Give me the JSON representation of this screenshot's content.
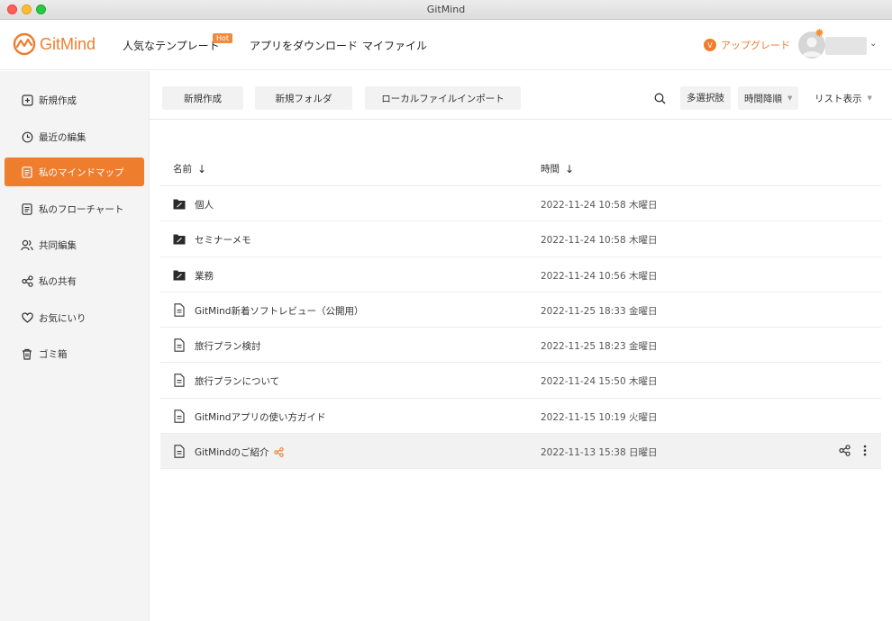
{
  "window": {
    "title": "GitMind"
  },
  "header": {
    "logo_text": "GitMind",
    "nav": [
      {
        "label": "人気なテンプレート",
        "badge": "Hot"
      },
      {
        "label": "アプリをダウンロード"
      },
      {
        "label": "マイファイル"
      }
    ],
    "upgrade_label": "アップグレード"
  },
  "sidebar": {
    "items": [
      {
        "label": "新規作成",
        "icon": "new-icon"
      },
      {
        "label": "最近の編集",
        "icon": "clock-icon"
      },
      {
        "label": "私のマインドマップ",
        "icon": "document-icon",
        "active": true
      },
      {
        "label": "私のフローチャート",
        "icon": "document-icon"
      },
      {
        "label": "共同編集",
        "icon": "users-icon"
      },
      {
        "label": "私の共有",
        "icon": "share-icon"
      },
      {
        "label": "お気にいり",
        "icon": "heart-icon"
      },
      {
        "label": "ゴミ箱",
        "icon": "trash-icon"
      }
    ]
  },
  "toolbar": {
    "new_label": "新規作成",
    "new_folder_label": "新規フォルダ",
    "import_label": "ローカルファイルインポート",
    "multi_select_label": "多選択肢",
    "sort_label": "時間降順",
    "view_label": "リスト表示"
  },
  "list": {
    "col_name": "名前",
    "col_time": "時間",
    "rows": [
      {
        "type": "folder",
        "name": "個人",
        "time": "2022-11-24 10:58 木曜日"
      },
      {
        "type": "folder",
        "name": "セミナーメモ",
        "time": "2022-11-24 10:58 木曜日"
      },
      {
        "type": "folder",
        "name": "業務",
        "time": "2022-11-24 10:56 木曜日"
      },
      {
        "type": "file",
        "name": "GitMind新着ソフトレビュー（公開用）",
        "time": "2022-11-25 18:33 金曜日"
      },
      {
        "type": "file",
        "name": "旅行プラン検討",
        "time": "2022-11-25 18:23 金曜日"
      },
      {
        "type": "file",
        "name": "旅行プランについて",
        "time": "2022-11-24 15:50 木曜日"
      },
      {
        "type": "file",
        "name": "GitMindアプリの使い方ガイド",
        "time": "2022-11-15 10:19 火曜日"
      },
      {
        "type": "file",
        "name": "GitMindのご紹介",
        "time": "2022-11-13 15:38 日曜日",
        "shared": true,
        "highlight": true
      }
    ]
  },
  "colors": {
    "accent": "#ef7d2e",
    "sidebar_bg": "#f4f4f4"
  }
}
